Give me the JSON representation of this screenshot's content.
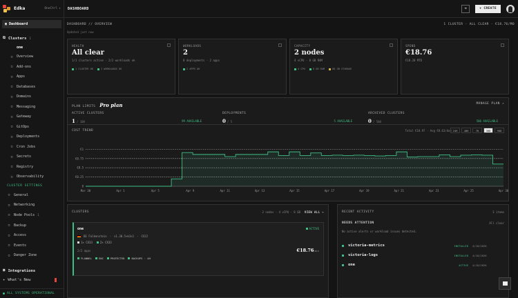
{
  "brand": {
    "name": "Edka",
    "org": "OneCtrl",
    "colors": {
      "accent": "#3fbf86",
      "logo_red": "#e5483b",
      "logo_amber": "#e09a2b",
      "logo_yellow": "#f2c14e"
    }
  },
  "sidebar": {
    "dashboard": "Dashboard",
    "clusters_label": "Clusters",
    "clusters_count": "1",
    "active_cluster": "one",
    "cluster_items": [
      {
        "label": "Overview",
        "icon": "overview-icon"
      },
      {
        "label": "Add-ons",
        "icon": "addons-icon"
      },
      {
        "label": "Apps",
        "icon": "apps-icon"
      },
      {
        "label": "Databases",
        "icon": "database-icon"
      },
      {
        "label": "Domains",
        "icon": "globe-icon"
      },
      {
        "label": "Messaging",
        "icon": "messaging-icon"
      },
      {
        "label": "Gateway",
        "icon": "gateway-icon"
      },
      {
        "label": "GitOps",
        "icon": "git-icon"
      },
      {
        "label": "Deployments",
        "icon": "deploy-icon"
      },
      {
        "label": "Cron Jobs",
        "icon": "clock-icon"
      },
      {
        "label": "Secrets",
        "icon": "key-icon"
      },
      {
        "label": "Registry",
        "icon": "registry-icon"
      },
      {
        "label": "Observability",
        "icon": "pulse-icon"
      }
    ],
    "settings_label": "CLUSTER SETTINGS",
    "settings_items": [
      {
        "label": "General",
        "icon": "sliders-icon"
      },
      {
        "label": "Networking",
        "icon": "network-icon"
      },
      {
        "label": "Node Pools",
        "icon": "server-icon",
        "badge": "1"
      },
      {
        "label": "Backup",
        "icon": "backup-icon"
      },
      {
        "label": "Access",
        "icon": "lock-icon"
      },
      {
        "label": "Events",
        "icon": "events-icon"
      },
      {
        "label": "Danger Zone",
        "icon": "warning-icon"
      }
    ],
    "integrations": "Integrations",
    "whats_new": "What's New",
    "status": "ALL SYSTEMS OPERATIONAL"
  },
  "topbar": {
    "title": "DASHBOARD",
    "create": "CREATE"
  },
  "header": {
    "crumb": "DASHBOARD // OVERVIEW",
    "summary": "1 CLUSTER · ALL CLEAR · €18.76/MO",
    "updated": "Updated just now"
  },
  "stats": [
    {
      "label": "HEALTH",
      "value": "All clear",
      "sub": "1/1 clusters active · 2/2 workloads ok",
      "tags": [
        {
          "color": "#3fbf86",
          "text": "1 CLUSTER OK"
        },
        {
          "color": "#3fbf86",
          "text": "2 WORKLOADS OK"
        }
      ]
    },
    {
      "label": "WORKLOADS",
      "value": "2",
      "sub": "0 deployments · 2 apps",
      "tags": [
        {
          "color": "#3fbf86",
          "text": "2 APPS OK"
        }
      ]
    },
    {
      "label": "CAPACITY",
      "value": "2 nodes",
      "sub": "4 vCPU · 8 GB RAM",
      "tags": [
        {
          "color": "#3fbf86",
          "text": "4 CPU"
        },
        {
          "color": "#3fbf86",
          "text": "8 GB RAM"
        },
        {
          "color": "#d6b34a",
          "text": "80 GB STORAGE"
        }
      ]
    },
    {
      "label": "SPEND",
      "value": "€18.76",
      "sub": "€18.20 MTD",
      "tags": []
    }
  ],
  "limits": {
    "label": "PLAN LIMITS",
    "plan": "Pro plan",
    "manage": "MANAGE PLAN ↗",
    "items": [
      {
        "title": "ACTIVE CLUSTERS",
        "used": "1",
        "max": "/ 100",
        "avail": "99 AVAILABLE"
      },
      {
        "title": "DEPLOYMENTS",
        "used": "0",
        "max": "/ 5",
        "avail": "5 AVAILABLE"
      },
      {
        "title": "ARCHIVED CLUSTERS",
        "used": "0",
        "max": "/ 500",
        "avail": "500 AVAILABLE"
      }
    ]
  },
  "trend": {
    "title": "COST TREND",
    "total": "Total €18.97 · Avg €0.63/day",
    "ranges": [
      "24H",
      "48H",
      "7D",
      "30D",
      "90D"
    ],
    "active_range": "30D"
  },
  "chart_data": {
    "type": "line",
    "title": "COST TREND",
    "x_ticks": [
      "Mar 30",
      "Apr 1",
      "Apr 5",
      "Apr 9",
      "Apr 11",
      "Apr 13",
      "Apr 15",
      "Apr 17",
      "Apr 19",
      "Apr 21",
      "Apr 23",
      "Apr 25",
      "Apr 30"
    ],
    "y_ticks": [
      "0",
      "€0.25",
      "€0.5",
      "€0.75",
      "€1"
    ],
    "ylim": [
      0,
      1.1
    ],
    "series": [
      {
        "values": [
          0.0,
          0.0,
          0.0,
          0.0,
          0.0,
          0.0,
          0.0,
          0.0,
          0.2,
          0.91,
          0.86,
          0.86,
          0.86,
          0.8,
          0.86,
          0.86,
          0.86,
          0.93,
          0.83,
          0.93,
          0.83,
          0.9,
          0.83,
          0.84,
          0.83,
          0.84,
          0.83,
          0.82,
          0.83,
          0.93,
          0.79,
          0.8,
          0.8,
          0.85,
          0.8,
          0.84,
          0.85,
          0.84,
          0.6
        ]
      }
    ],
    "grid": true
  },
  "clusters_panel": {
    "title": "CLUSTERS",
    "meta": "2 nodes · 4 vCPU · 8 GB",
    "view_all": "VIEW ALL →",
    "cluster": {
      "name": "one",
      "status": "ACTIVE",
      "location": "DE Falkenstein",
      "version": "v1.30.5+k3s1",
      "type": "CX22",
      "nodes": [
        "1× CX33",
        "2× CX33"
      ],
      "apps": "2/2 apps",
      "cost": "€18.76",
      "cost_unit": "/mo",
      "features": [
        "FLANNEL",
        "ENC",
        "PROTECTED",
        "BACKUPS · 4H"
      ]
    }
  },
  "activity": {
    "title": "RECENT ACTIVITY",
    "count": "3 items",
    "needs_attention": "NEEDS ATTENTION",
    "needs_right": "All clear",
    "needs_sub": "No active alerts or workload issues detected.",
    "items": [
      {
        "name": "victoria-metrics",
        "status": "INSTALLED",
        "date": "4/18/2026"
      },
      {
        "name": "victoria-logs",
        "status": "INSTALLED",
        "date": "4/18/2026"
      },
      {
        "name": "one",
        "status": "ACTIVE",
        "date": "4/18/2026"
      }
    ]
  }
}
